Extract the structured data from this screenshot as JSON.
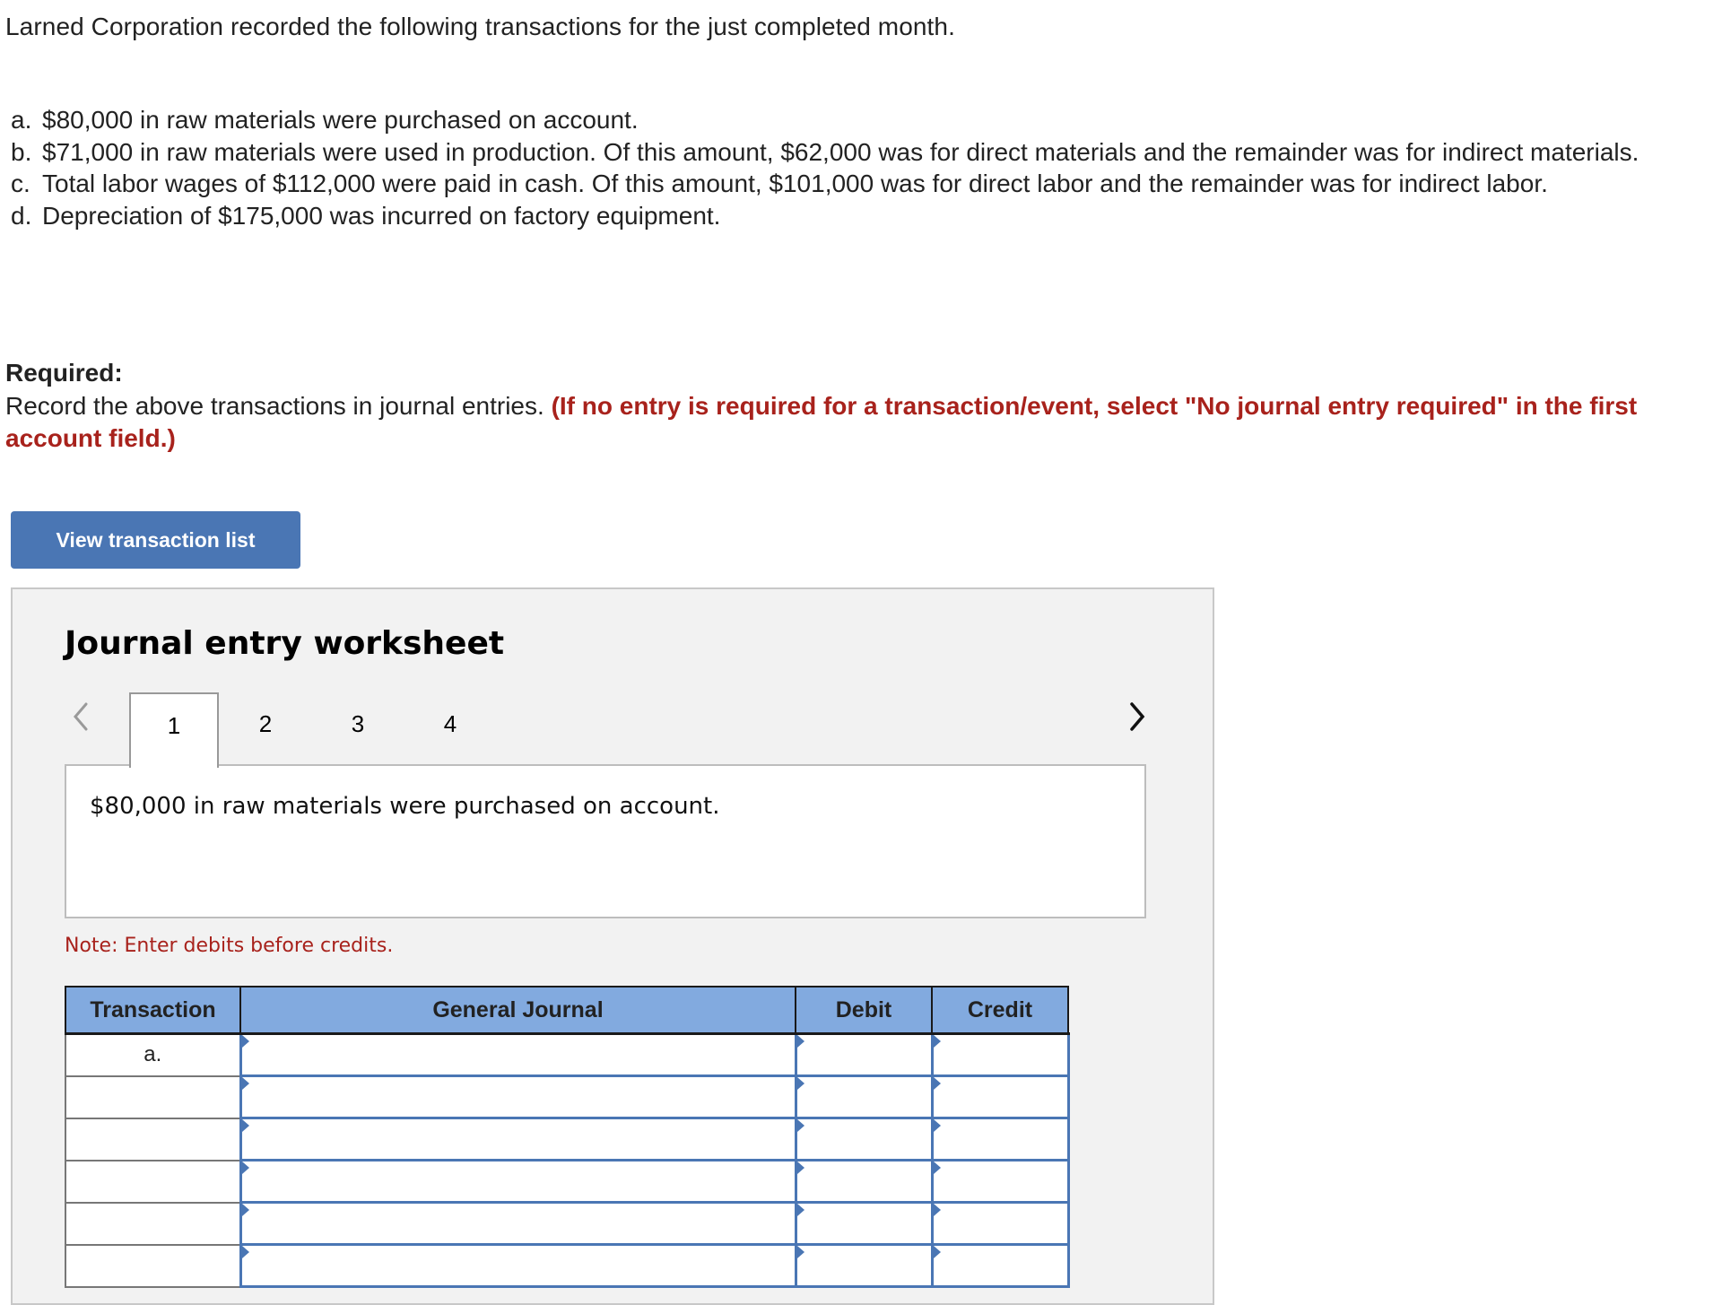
{
  "intro": "Larned Corporation recorded the following transactions for the just completed month.",
  "transactions": [
    {
      "label": "a.",
      "text": "$80,000 in raw materials were purchased on account."
    },
    {
      "label": "b.",
      "text": "$71,000 in raw materials were used in production. Of this amount, $62,000 was for direct materials and the remainder was for indirect materials."
    },
    {
      "label": "c.",
      "text": "Total labor wages of $112,000 were paid in cash. Of this amount, $101,000 was for direct labor and the remainder was for indirect labor."
    },
    {
      "label": "d.",
      "text": "Depreciation of $175,000 was incurred on factory equipment."
    }
  ],
  "required": {
    "title": "Required:",
    "text": "Record the above transactions in journal entries.",
    "instruction": "(If no entry is required for a transaction/event, select \"No journal entry required\" in the first account field.)"
  },
  "view_button": "View transaction list",
  "worksheet": {
    "title": "Journal entry worksheet",
    "tabs": [
      "1",
      "2",
      "3",
      "4"
    ],
    "active_tab": "1",
    "description": "$80,000 in raw materials were purchased on account.",
    "note": "Note: Enter debits before credits.",
    "columns": [
      "Transaction",
      "General Journal",
      "Debit",
      "Credit"
    ],
    "rows": [
      {
        "transaction": "a.",
        "account": "",
        "debit": "",
        "credit": ""
      },
      {
        "transaction": "",
        "account": "",
        "debit": "",
        "credit": ""
      },
      {
        "transaction": "",
        "account": "",
        "debit": "",
        "credit": ""
      },
      {
        "transaction": "",
        "account": "",
        "debit": "",
        "credit": ""
      },
      {
        "transaction": "",
        "account": "",
        "debit": "",
        "credit": ""
      },
      {
        "transaction": "",
        "account": "",
        "debit": "",
        "credit": ""
      }
    ]
  },
  "colors": {
    "button": "#4a76b4",
    "header": "#82aadf",
    "accent_red": "#a8221c"
  }
}
